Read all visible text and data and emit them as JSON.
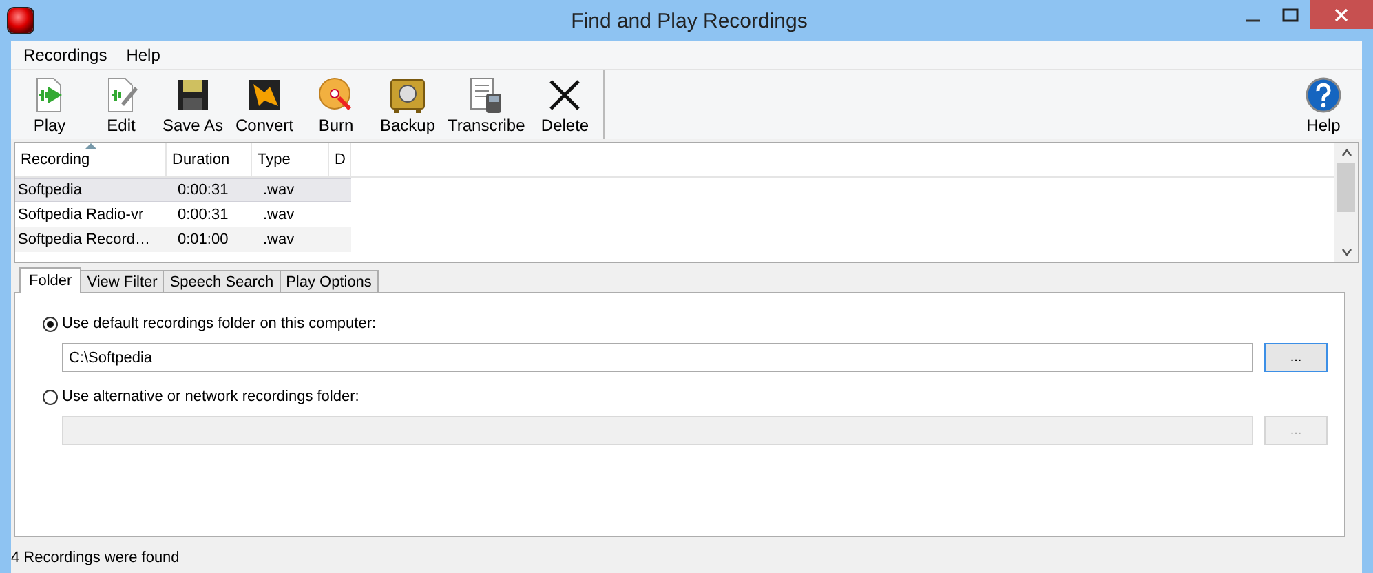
{
  "window": {
    "title": "Find and Play Recordings"
  },
  "menu": [
    "Recordings",
    "Help"
  ],
  "toolbar": [
    {
      "label": "Play",
      "kind": "play"
    },
    {
      "label": "Edit",
      "kind": "edit"
    },
    {
      "label": "Save As",
      "kind": "save"
    },
    {
      "label": "Convert",
      "kind": "convert"
    },
    {
      "label": "Burn",
      "kind": "burn"
    },
    {
      "label": "Backup",
      "kind": "backup"
    },
    {
      "label": "Transcribe",
      "kind": "transcribe"
    },
    {
      "label": "Delete",
      "kind": "delete"
    }
  ],
  "help_button": {
    "label": "Help"
  },
  "table": {
    "columns": [
      {
        "label": "Recording",
        "sorted": true
      },
      {
        "label": "Duration",
        "sorted": false
      },
      {
        "label": "Type",
        "sorted": false
      },
      {
        "label": "D",
        "sorted": false
      }
    ],
    "rows": [
      {
        "cells": [
          "Softpedia",
          "0:00:31",
          ".wav"
        ],
        "selected": true
      },
      {
        "cells": [
          "Softpedia Radio-vr",
          "0:00:31",
          ".wav"
        ],
        "selected": false
      },
      {
        "cells": [
          "Softpedia Record…",
          "0:01:00",
          ".wav"
        ],
        "selected": false
      }
    ]
  },
  "tabs": [
    {
      "label": "Folder",
      "selected": true
    },
    {
      "label": "View Filter",
      "selected": false
    },
    {
      "label": "Speech Search",
      "selected": false
    },
    {
      "label": "Play Options",
      "selected": false
    }
  ],
  "folder_options": [
    {
      "label": "Use default recordings folder on this computer:",
      "selected": true,
      "path": "C:\\Softpedia",
      "browse": "...",
      "disabled": false
    },
    {
      "label": "Use alternative or network recordings folder:",
      "selected": false,
      "browse": "...",
      "disabled": true
    }
  ],
  "status_bar": "4 Recordings were found"
}
